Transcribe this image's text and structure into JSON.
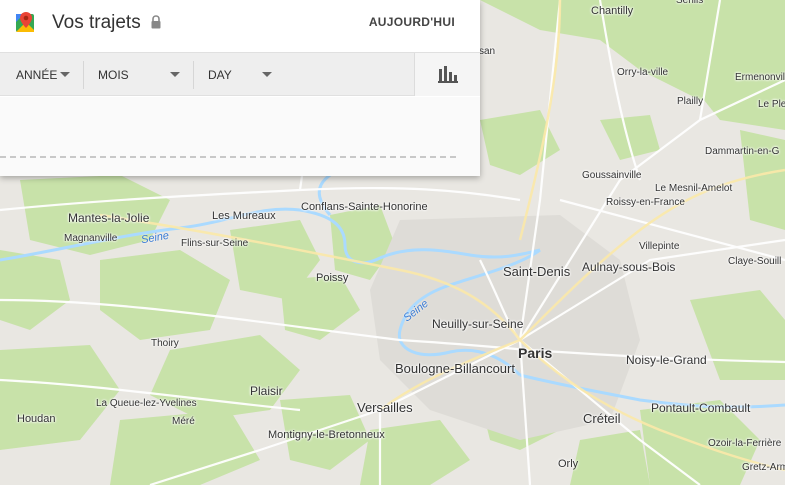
{
  "panel": {
    "title": "Vos trajets",
    "today_label": "AUJOURD'HUI"
  },
  "filters": {
    "year_label": "ANNÉE",
    "month_label": "MOIS",
    "day_label": "DAY"
  },
  "icons": {
    "logo": "google-maps-pin-icon",
    "lock": "lock-icon",
    "chart": "bar-chart-icon"
  },
  "map": {
    "places": [
      {
        "name": "Chantilly",
        "size": "s"
      },
      {
        "name": "Orry-la-ville",
        "size": "xs"
      },
      {
        "name": "Ermenonville",
        "size": "xs"
      },
      {
        "name": "Plailly",
        "size": "xs"
      },
      {
        "name": "Le Ple",
        "size": "xs"
      },
      {
        "name": "Dammartin-en-G",
        "size": "xs"
      },
      {
        "name": "Goussainville",
        "size": "xs"
      },
      {
        "name": "Le Mesnil-Amelot",
        "size": "xs"
      },
      {
        "name": "Roissy-en-France",
        "size": "xs"
      },
      {
        "name": "Mantes-la-Jolie",
        "size": "m"
      },
      {
        "name": "Les Mureaux",
        "size": "s"
      },
      {
        "name": "Conflans-Sainte-Honorine",
        "size": "s"
      },
      {
        "name": "Magnanville",
        "size": "xs"
      },
      {
        "name": "Flins-sur-Seine",
        "size": "xs"
      },
      {
        "name": "Villepinte",
        "size": "xs"
      },
      {
        "name": "Claye-Souill",
        "size": "xs"
      },
      {
        "name": "Saint-Denis",
        "size": "l"
      },
      {
        "name": "Aulnay-sous-Bois",
        "size": "m"
      },
      {
        "name": "Poissy",
        "size": "s"
      },
      {
        "name": "Neuilly-sur-Seine",
        "size": "m"
      },
      {
        "name": "Thoiry",
        "size": "xs"
      },
      {
        "name": "Paris",
        "size": "xl"
      },
      {
        "name": "Noisy-le-Grand",
        "size": "m"
      },
      {
        "name": "Boulogne-Billancourt",
        "size": "l"
      },
      {
        "name": "Plaisir",
        "size": "m"
      },
      {
        "name": "La Queue-lez-Yvelines",
        "size": "xs"
      },
      {
        "name": "Versailles",
        "size": "l"
      },
      {
        "name": "Houdan",
        "size": "s"
      },
      {
        "name": "Méré",
        "size": "xs"
      },
      {
        "name": "Créteil",
        "size": "l"
      },
      {
        "name": "Pontault-Combault",
        "size": "m"
      },
      {
        "name": "Montigny-le-Bretonneux",
        "size": "s"
      },
      {
        "name": "Ozoir-la-Ferrière",
        "size": "xs"
      },
      {
        "name": "Orly",
        "size": "s"
      },
      {
        "name": "Gretz-Arm",
        "size": "xs"
      },
      {
        "name": "Senlis",
        "size": "xs"
      },
      {
        "name": "san",
        "size": "xs"
      }
    ],
    "rivers": [
      {
        "name": "Seine"
      },
      {
        "name": "Seine"
      }
    ]
  }
}
